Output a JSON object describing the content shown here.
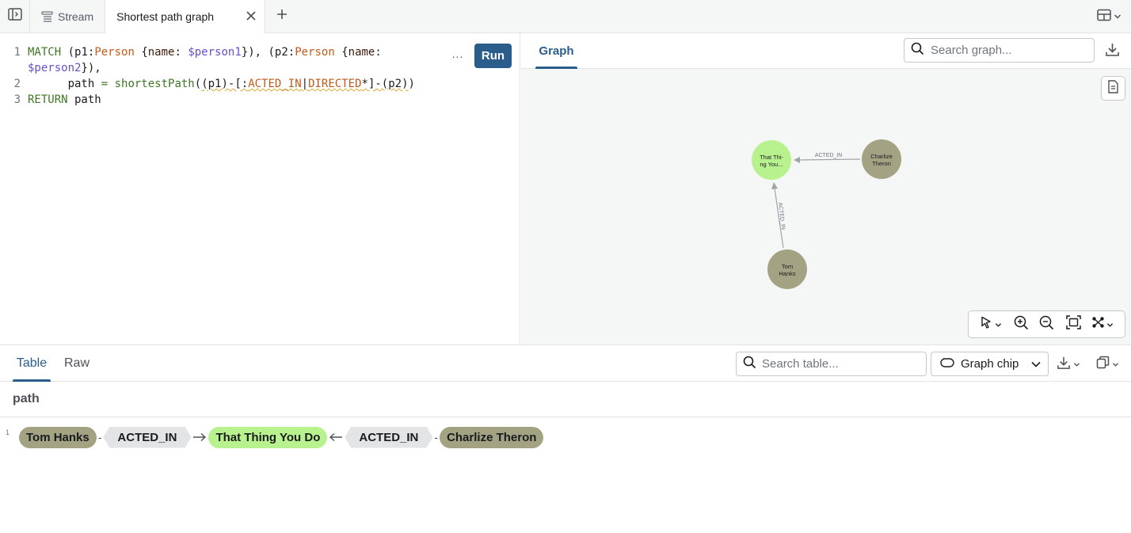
{
  "tabs": {
    "stream_label": "Stream",
    "active_label": "Shortest path graph"
  },
  "editor": {
    "line_numbers": [
      "1",
      "2",
      "3"
    ],
    "more_label": "...",
    "run_label": "Run"
  },
  "graph": {
    "tab_label": "Graph",
    "search_placeholder": "Search graph...",
    "nodes": [
      {
        "label_line1": "That Thi-",
        "label_line2": "ng You...",
        "color": "#b8f28f"
      },
      {
        "label_line1": "Charlize",
        "label_line2": "Theron",
        "color": "#a3a384"
      },
      {
        "label_line1": "Tom",
        "label_line2": "Hanks",
        "color": "#a3a384"
      }
    ],
    "edges": [
      {
        "label": "ACTED_IN"
      },
      {
        "label": "ACTED_IN"
      }
    ]
  },
  "results": {
    "tab_table": "Table",
    "tab_raw": "Raw",
    "search_placeholder": "Search table...",
    "chip_mode": "Graph chip",
    "column": "path",
    "rows": [
      {
        "index": "1",
        "start": "Tom Hanks",
        "rel1": "ACTED_IN",
        "mid": "That Thing You Do",
        "rel2": "ACTED_IN",
        "end": "Charlize Theron"
      }
    ]
  },
  "colors": {
    "accent": "#2a5d8c",
    "person_node": "#a3a384",
    "movie_node": "#b8f28f",
    "relationship_chip": "#e3e4e6"
  }
}
